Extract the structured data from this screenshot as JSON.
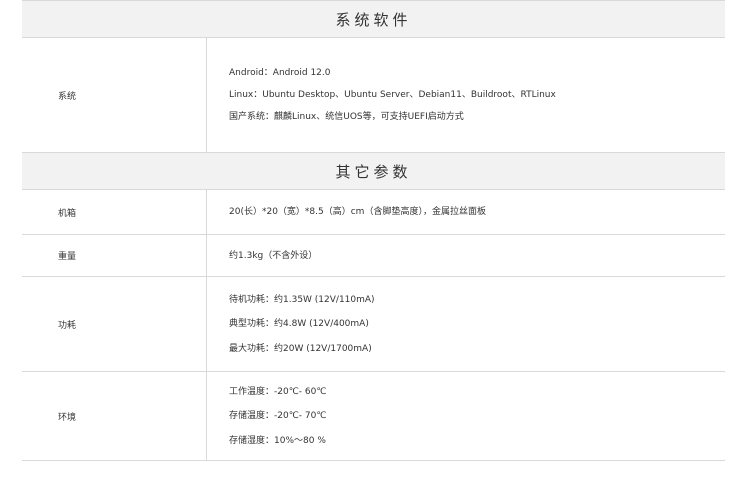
{
  "sections": [
    {
      "title": "系统软件",
      "rows": [
        {
          "label": "系统",
          "lines": [
            "Android：Android 12.0",
            "Linux：Ubuntu Desktop、Ubuntu Server、Debian11、Buildroot、RTLinux",
            "国产系统：麒麟Linux、统信UOS等，可支持UEFI启动方式"
          ]
        }
      ]
    },
    {
      "title": "其它参数",
      "rows": [
        {
          "label": "机箱",
          "lines": [
            "20(长）*20（宽）*8.5（高）cm（含脚垫高度），金属拉丝面板"
          ]
        },
        {
          "label": "重量",
          "lines": [
            "约1.3kg（不含外设）"
          ]
        },
        {
          "label": "功耗",
          "lines": [
            "待机功耗：约1.35W (12V/110mA)",
            "典型功耗：约4.8W (12V/400mA)",
            "最大功耗：约20W (12V/1700mA)"
          ]
        },
        {
          "label": "环境",
          "lines": [
            "工作温度：-20℃- 60℃",
            "存储温度：-20℃- 70℃",
            "存储湿度：10%～80 %"
          ]
        }
      ]
    }
  ]
}
